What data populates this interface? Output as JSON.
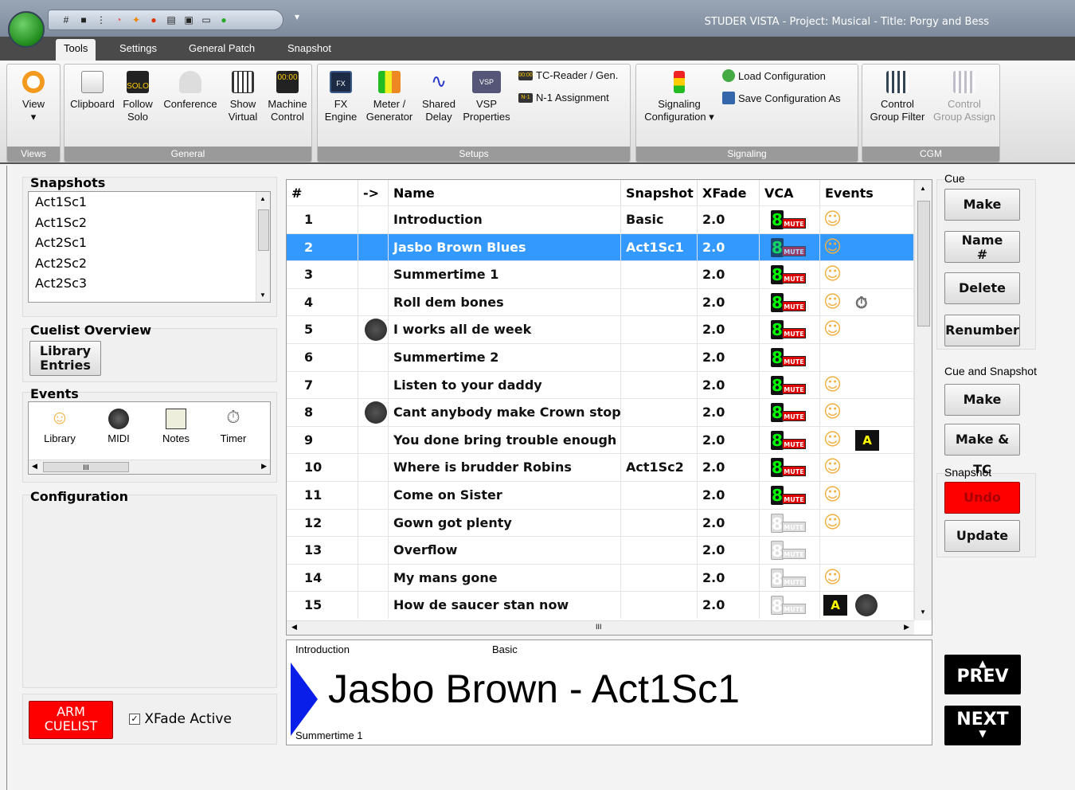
{
  "window": {
    "title": "STUDER VISTA - Project: Musical - Title: Porgy and Bess",
    "qat_more": "▾"
  },
  "ribbon": {
    "tabs": [
      "Tools",
      "Settings",
      "General Patch",
      "Snapshot"
    ],
    "groups": {
      "views": {
        "label": "Views",
        "view": "View",
        "view_arrow": "▾"
      },
      "general": {
        "label": "General",
        "clipboard": "Clipboard",
        "follow_solo": [
          "Follow",
          "Solo"
        ],
        "conference": "Conference",
        "show_virtual": [
          "Show",
          "Virtual"
        ],
        "machine_control": [
          "Machine",
          "Control"
        ],
        "solo_badge": "SOLO",
        "machine_badge": "00:00"
      },
      "setups": {
        "label": "Setups",
        "fx_engine": [
          "FX",
          "Engine"
        ],
        "meter_generator": [
          "Meter /",
          "Generator"
        ],
        "shared_delay": [
          "Shared",
          "Delay"
        ],
        "vsp_properties": [
          "VSP",
          "Properties"
        ],
        "tc_reader": "TC-Reader / Gen.",
        "n1_assignment": "N-1 Assignment",
        "fx_badge": "FX",
        "vsp_badge": "VSP",
        "tc_badge": "00:00",
        "n1_badge": "N-1"
      },
      "signaling": {
        "label": "Signaling",
        "signaling_config": [
          "Signaling",
          "Configuration ▾"
        ],
        "load_config": "Load Configuration",
        "save_config": "Save Configuration As"
      },
      "cgm": {
        "label": "CGM",
        "control_group_filter": [
          "Control",
          "Group Filter"
        ],
        "control_group_assign": [
          "Control",
          "Group Assign"
        ]
      }
    }
  },
  "left": {
    "snapshots": {
      "title": "Snapshots",
      "items": [
        "Act1Sc1",
        "Act1Sc2",
        "Act2Sc1",
        "Act2Sc2",
        "Act2Sc3"
      ]
    },
    "cuelist_overview": {
      "title": "Cuelist Overview",
      "library_entries": [
        "Library",
        "Entries"
      ]
    },
    "events": {
      "title": "Events",
      "items": [
        "Library",
        "MIDI",
        "Notes",
        "Timer"
      ],
      "scroll_mark": "III"
    },
    "configuration": {
      "title": "Configuration"
    },
    "arm_cuelist": [
      "ARM",
      "CUELIST"
    ],
    "xfade_active": "XFade Active",
    "xfade_checked": "✓"
  },
  "grid": {
    "headers": [
      "#",
      "->",
      "Name",
      "Snapshot",
      "XFade",
      "VCA",
      "Events"
    ],
    "selected_index": 1,
    "mute_label": "MUTE",
    "vca_digit": "8",
    "hscroll_mark": "III",
    "rows": [
      {
        "num": "1",
        "name": "Introduction",
        "snapshot": "Basic",
        "xfade": "2.0",
        "vca": "on",
        "events": [
          "library"
        ],
        "midi": false
      },
      {
        "num": "2",
        "name": "Jasbo Brown Blues",
        "snapshot": "Act1Sc1",
        "xfade": "2.0",
        "vca": "sel",
        "events": [
          "library"
        ],
        "midi": false
      },
      {
        "num": "3",
        "name": "Summertime 1",
        "snapshot": "",
        "xfade": "2.0",
        "vca": "on",
        "events": [
          "library"
        ],
        "midi": false
      },
      {
        "num": "4",
        "name": "Roll dem bones",
        "snapshot": "",
        "xfade": "2.0",
        "vca": "on",
        "events": [
          "library",
          "timer"
        ],
        "midi": false
      },
      {
        "num": "5",
        "name": "I works all de week",
        "snapshot": "",
        "xfade": "2.0",
        "vca": "on",
        "events": [
          "library"
        ],
        "midi": true
      },
      {
        "num": "6",
        "name": "Summertime 2",
        "snapshot": "",
        "xfade": "2.0",
        "vca": "on",
        "events": [],
        "midi": false
      },
      {
        "num": "7",
        "name": "Listen to your daddy",
        "snapshot": "",
        "xfade": "2.0",
        "vca": "on",
        "events": [
          "library"
        ],
        "midi": false
      },
      {
        "num": "8",
        "name": "Cant anybody make Crown stop",
        "snapshot": "",
        "xfade": "2.0",
        "vca": "on",
        "events": [
          "library"
        ],
        "midi": true
      },
      {
        "num": "9",
        "name": "You done bring trouble enough",
        "snapshot": "",
        "xfade": "2.0",
        "vca": "on",
        "events": [
          "library",
          "autoplay"
        ],
        "midi": false
      },
      {
        "num": "10",
        "name": "Where is brudder Robins",
        "snapshot": "Act1Sc2",
        "xfade": "2.0",
        "vca": "on",
        "events": [
          "library"
        ],
        "midi": false
      },
      {
        "num": "11",
        "name": "Come on Sister",
        "snapshot": "",
        "xfade": "2.0",
        "vca": "on",
        "events": [
          "library"
        ],
        "midi": false
      },
      {
        "num": "12",
        "name": "Gown got plenty",
        "snapshot": "",
        "xfade": "2.0",
        "vca": "off",
        "events": [
          "library"
        ],
        "midi": false
      },
      {
        "num": "13",
        "name": "Overflow",
        "snapshot": "",
        "xfade": "2.0",
        "vca": "off",
        "events": [],
        "midi": false
      },
      {
        "num": "14",
        "name": "My mans gone",
        "snapshot": "",
        "xfade": "2.0",
        "vca": "off",
        "events": [
          "library"
        ],
        "midi": false
      },
      {
        "num": "15",
        "name": "How de saucer stan now",
        "snapshot": "",
        "xfade": "2.0",
        "vca": "off",
        "events": [
          "autoplay",
          "midi"
        ],
        "midi": false
      }
    ]
  },
  "display": {
    "prev_cue": "Introduction",
    "prev_snapshot": "Basic",
    "current": "Jasbo Brown  - Act1Sc1",
    "next_cue": "Summertime 1"
  },
  "right": {
    "cue_label": "Cue",
    "make": "Make",
    "name_hash": [
      "Name",
      "#"
    ],
    "delete": "Delete",
    "renumber": "Renumber",
    "cue_and_snapshot": "Cue and Snapshot",
    "make2": "Make",
    "make_tc": "Make & TC",
    "snapshot_label": "Snapshot",
    "undo": "Undo",
    "update": "Update",
    "prev": "PREV",
    "next": "NEXT",
    "undo_color": "#ff0000"
  }
}
